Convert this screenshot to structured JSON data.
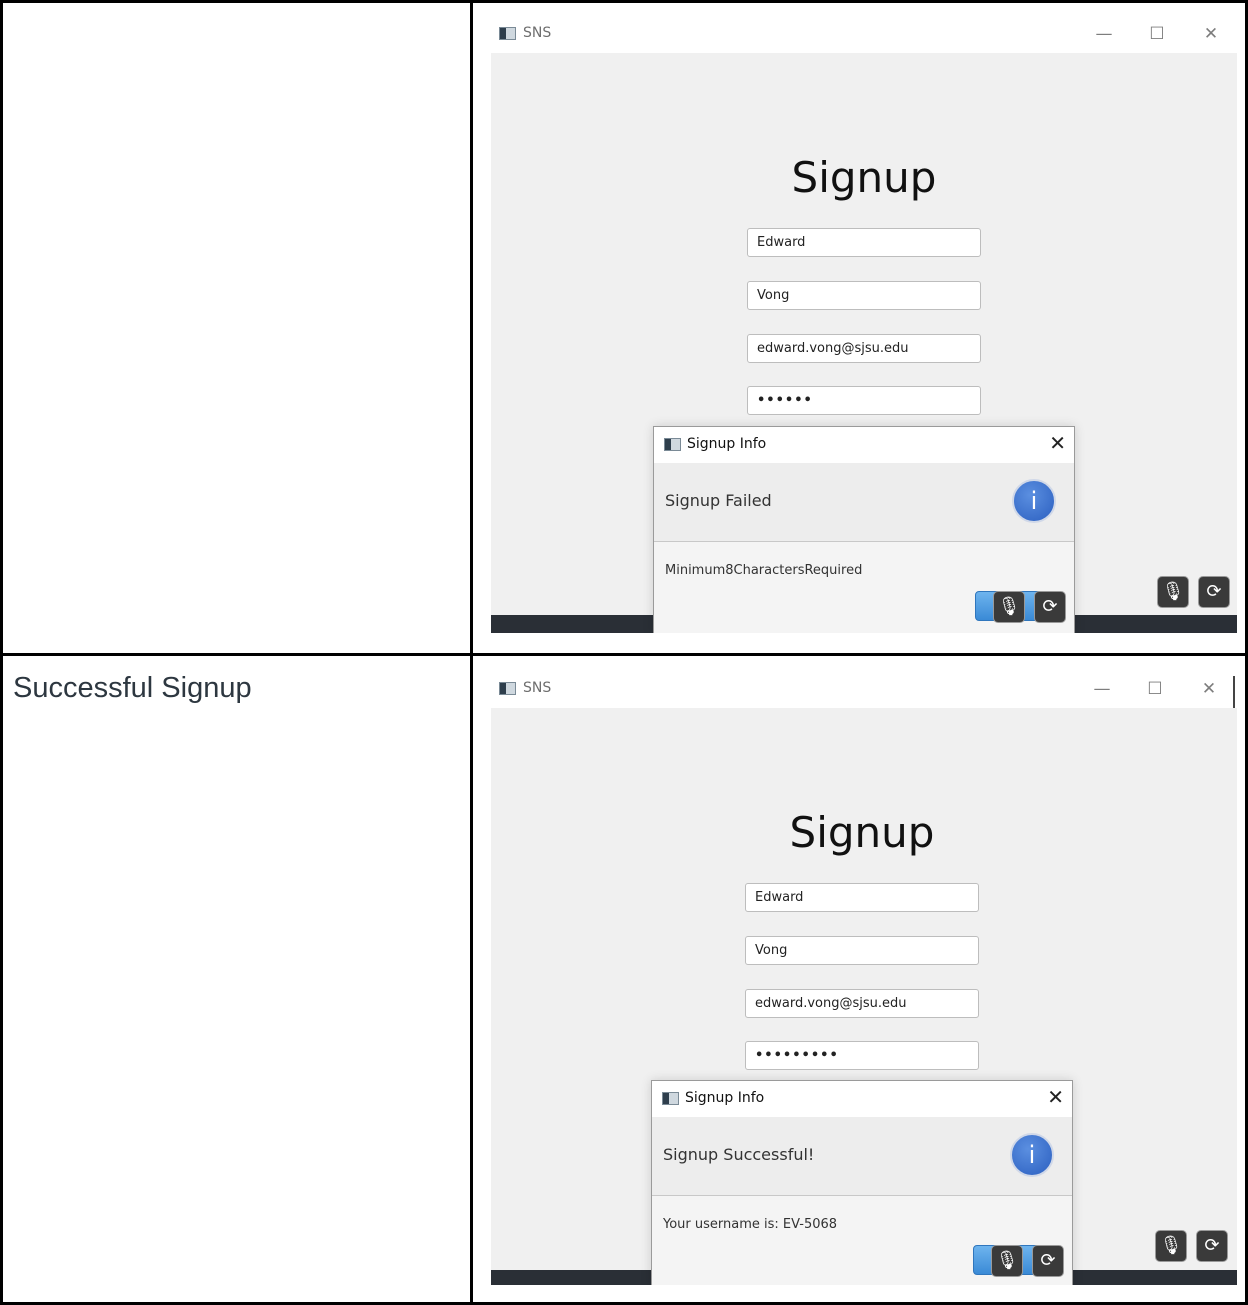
{
  "rows": [
    {
      "label": "",
      "window": {
        "title": "SNS",
        "heading": "Signup",
        "fields": [
          "Edward",
          "Vong",
          "edward.vong@sjsu.edu",
          "••••••"
        ],
        "dialog": {
          "title": "Signup Info",
          "header": "Signup Failed",
          "message": "Minimum8CharactersRequired"
        }
      }
    },
    {
      "label": "Successful Signup",
      "window": {
        "title": "SNS",
        "heading": "Signup",
        "fields": [
          "Edward",
          "Vong",
          "edward.vong@sjsu.edu",
          "•••••••••"
        ],
        "dialog": {
          "title": "Signup Info",
          "header": "Signup Successful!",
          "message": "Your username is: EV-5068"
        }
      }
    }
  ],
  "controls": {
    "minimize": "—",
    "maximize": "☐",
    "close": "✕",
    "dialog_close": "✕",
    "info_glyph": "i",
    "mic_glyph": "🎙",
    "refresh_glyph": "⟳"
  },
  "icons": [
    "app-window-icon",
    "info-icon",
    "microphone-icon",
    "refresh-icon",
    "close-icon",
    "minimize-icon",
    "maximize-icon"
  ]
}
